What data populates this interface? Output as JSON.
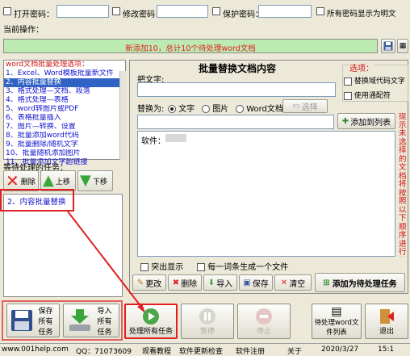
{
  "top_bar": {
    "open_pwd_label": "打开密码：",
    "modify_pwd_label": "修改密码：",
    "protect_pwd_label": "保护密码：",
    "show_plain_label": "所有密码显示为明文"
  },
  "current_op": {
    "label": "当前操作："
  },
  "progress": {
    "text": "新添加10，总计10个待处理word文档",
    "value": 1.0
  },
  "left_panel": {
    "title": "word文档批量处理选项：",
    "items": [
      "1、Excel、Word模板批量新文件",
      "2、内容批量替换",
      "3、格式处理—文档、段落",
      "4、格式处理—表格",
      "5、word转图片或PDF",
      "6、表格批量插入",
      "7、图片—转换、设置",
      "8、批量添加word代码",
      "9、批量删除/随机文字",
      "10、批量随机添加图片",
      "11、批量添加文字超链接"
    ],
    "selected_index": 1,
    "queue_title": "等待处理的任务：",
    "queue_items": [
      "2、内容批量替换"
    ],
    "delete_btn": "删除",
    "up_btn": "上移",
    "down_btn": "下移"
  },
  "right_panel": {
    "title": "批量替换文档内容",
    "find_label": "把文字:",
    "replace_label": "替换为:",
    "opt_text": "文字",
    "opt_image": "图片",
    "opt_word": "Word文档",
    "select_btn": "选择",
    "add_to_list_btn": "添加到列表",
    "list_entry": "软件：",
    "options_title": "选项：",
    "opt_code": "替换域代码文字",
    "opt_regex": "使用通配符",
    "side_note": "提示：未选择的文档将按照以下顺序进行替换操作，可同时输入多个替换内容后添加到列表",
    "highlight_label": "突出显示",
    "each_file_label": "每一词条生成一个文件",
    "modify_btn": "更改",
    "delete_btn": "删除",
    "import_btn": "导入",
    "save_btn": "保存",
    "clear_btn": "清空",
    "add_task_btn": "添加为待处理任务"
  },
  "bottom": {
    "save_all": "保存所有任务",
    "import_all": "导入所有任务",
    "process_all": "处理所有任务",
    "pause": "暂停",
    "stop": "停止",
    "pending_list": "待处理word文件列表",
    "exit": "退出"
  },
  "status_bar": {
    "site": "www.001help.com",
    "qq": "QQ：71073609",
    "tutorial": "观看教程",
    "update": "软件更新检查",
    "register": "软件注册",
    "about": "关于",
    "date": "2020/3/27",
    "time": "15:1"
  },
  "colors": {
    "accent_red": "#e02020",
    "title_blue": "#1010d0",
    "progress_green": "#bdeab2"
  }
}
